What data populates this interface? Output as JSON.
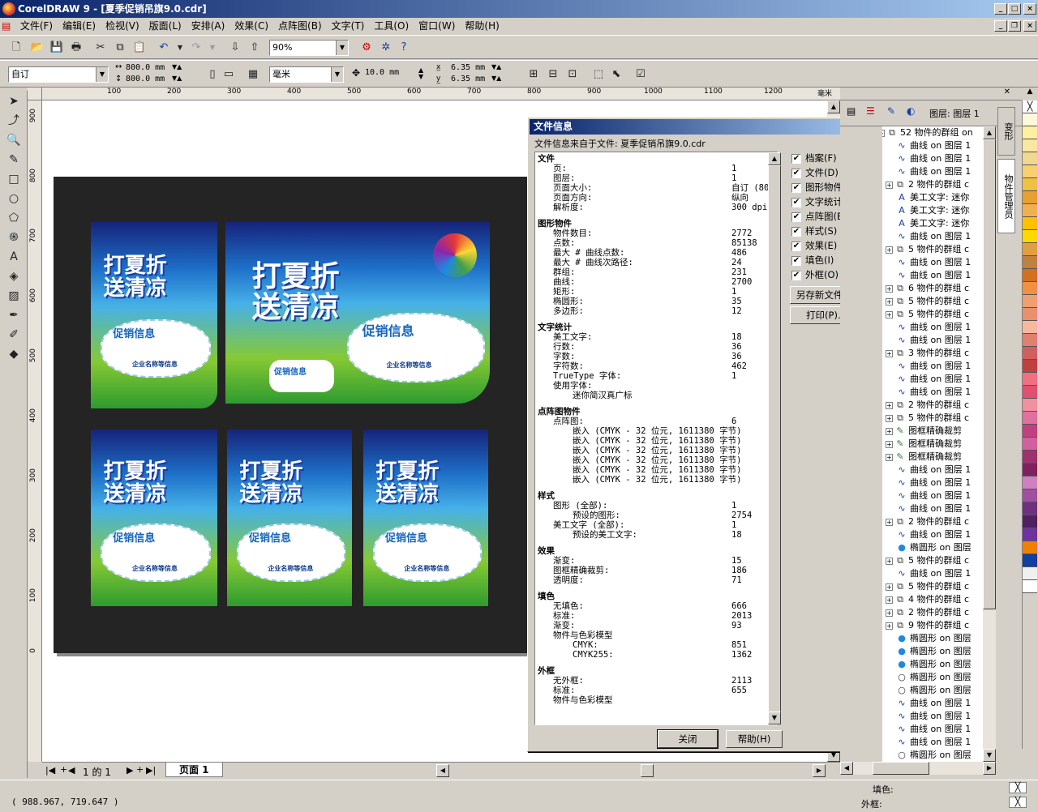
{
  "window": {
    "title": "CorelDRAW 9 - [夏季促销吊旗9.0.cdr]"
  },
  "menu": [
    "文件(F)",
    "编辑(E)",
    "检视(V)",
    "版面(L)",
    "安排(A)",
    "效果(C)",
    "点阵图(B)",
    "文字(T)",
    "工具(O)",
    "窗口(W)",
    "帮助(H)"
  ],
  "toolbar": {
    "zoom": "90%"
  },
  "propbar": {
    "paper": "自订",
    "width": "800.0",
    "height": "800.0",
    "unit_wh": "mm",
    "units": "毫米",
    "nudge": "10.0 mm",
    "dup_x": "6.35",
    "dup_y": "6.35",
    "dup_unit": "mm"
  },
  "ruler": {
    "h": [
      "100",
      "200",
      "300",
      "400",
      "500",
      "600",
      "700",
      "800",
      "900",
      "1000",
      "1100",
      "1200",
      "毫米"
    ],
    "v": [
      "900",
      "800",
      "700",
      "600",
      "500",
      "400",
      "300",
      "200",
      "100",
      "0"
    ]
  },
  "posters": {
    "title1": "打夏折",
    "title2": "送清凉",
    "bubble": "促销信息",
    "sub": "企业名称等信息"
  },
  "dialog": {
    "title": "文件信息",
    "help": "?",
    "source": "文件信息来自于文件: 夏季促销吊旗9.0.cdr",
    "rows": [
      {
        "h": "文件"
      },
      {
        "l": "页:",
        "v": "1"
      },
      {
        "l": "图层:",
        "v": "1"
      },
      {
        "l": "页面大小:",
        "v": "自订 (80"
      },
      {
        "l": "页面方向:",
        "v": "纵向"
      },
      {
        "l": "解析度:",
        "v": "300 dpi"
      },
      {
        "gap": true
      },
      {
        "h": "图形物件"
      },
      {
        "l": "物件数目:",
        "v": "2772"
      },
      {
        "l": "点数:",
        "v": "85138"
      },
      {
        "l": "最大 # 曲线点数:",
        "v": "486"
      },
      {
        "l": "最大 # 曲线次路径:",
        "v": "24"
      },
      {
        "l": "群组:",
        "v": "231"
      },
      {
        "l": "曲线:",
        "v": "2700"
      },
      {
        "l": "矩形:",
        "v": "1"
      },
      {
        "l": "椭圆形:",
        "v": "35"
      },
      {
        "l": "多边形:",
        "v": "12"
      },
      {
        "gap": true
      },
      {
        "h": "文字统计"
      },
      {
        "l": "美工文字:",
        "v": "18"
      },
      {
        "l": "行数:",
        "v": "36"
      },
      {
        "l": "字数:",
        "v": "36"
      },
      {
        "l": "字符数:",
        "v": "462"
      },
      {
        "l": "TrueType 字体:",
        "v": "1"
      },
      {
        "l": "使用字体:",
        "v": ""
      },
      {
        "l2": "迷你简汉真广标",
        "v": ""
      },
      {
        "gap": true
      },
      {
        "h": "点阵图物件"
      },
      {
        "l": "点阵图:",
        "v": "6"
      },
      {
        "l2": "嵌入 (CMYK - 32 位元, 1611380 字节)",
        "v": ""
      },
      {
        "l2": "嵌入 (CMYK - 32 位元, 1611380 字节)",
        "v": ""
      },
      {
        "l2": "嵌入 (CMYK - 32 位元, 1611380 字节)",
        "v": ""
      },
      {
        "l2": "嵌入 (CMYK - 32 位元, 1611380 字节)",
        "v": ""
      },
      {
        "l2": "嵌入 (CMYK - 32 位元, 1611380 字节)",
        "v": ""
      },
      {
        "l2": "嵌入 (CMYK - 32 位元, 1611380 字节)",
        "v": ""
      },
      {
        "gap": true
      },
      {
        "h": "样式"
      },
      {
        "l": "图形 (全部):",
        "v": "1"
      },
      {
        "l2": "预设的图形:",
        "v": "2754"
      },
      {
        "l": "美工文字 (全部):",
        "v": "1"
      },
      {
        "l2": "预设的美工文字:",
        "v": "18"
      },
      {
        "gap": true
      },
      {
        "h": "效果"
      },
      {
        "l": "渐变:",
        "v": "15"
      },
      {
        "l": "图框精确裁剪:",
        "v": "186"
      },
      {
        "l": "透明度:",
        "v": "71"
      },
      {
        "gap": true
      },
      {
        "h": "填色"
      },
      {
        "l": "无填色:",
        "v": "666"
      },
      {
        "l": "标准:",
        "v": "2013"
      },
      {
        "l": "渐变:",
        "v": "93"
      },
      {
        "l": "物件与色彩模型",
        "v": ""
      },
      {
        "l2": "CMYK:",
        "v": "851"
      },
      {
        "l2": "CMYK255:",
        "v": "1362"
      },
      {
        "gap": true
      },
      {
        "h": "外框"
      },
      {
        "l": "无外框:",
        "v": "2113"
      },
      {
        "l": "标准:",
        "v": "655"
      },
      {
        "l": "物件与色彩模型",
        "v": ""
      }
    ],
    "checks": [
      "档案(F)",
      "文件(D)",
      "图形物件(G)",
      "文字统计(T)",
      "点阵图(B)",
      "样式(S)",
      "效果(E)",
      "填色(I)",
      "外框(O)"
    ],
    "save_btn": "另存新文件(A)",
    "print_btn": "打印(P)...",
    "close_btn": "关闭",
    "help_btn": "帮助(H)"
  },
  "objects": {
    "header": "图层: 图层 1",
    "items": [
      {
        "t": "52 物件的群组 on",
        "ic": "grp",
        "pm": "-",
        "lvl": 0
      },
      {
        "t": "曲线 on 图层 1",
        "ic": "crv",
        "lvl": 1
      },
      {
        "t": "曲线 on 图层 1",
        "ic": "crv",
        "lvl": 1
      },
      {
        "t": "曲线 on 图层 1",
        "ic": "crv",
        "lvl": 1
      },
      {
        "t": "2 物件的群组 c",
        "ic": "grp",
        "pm": "+",
        "lvl": 1
      },
      {
        "t": "美工文字: 迷你",
        "ic": "txt",
        "lvl": 1
      },
      {
        "t": "美工文字: 迷你",
        "ic": "txt",
        "lvl": 1
      },
      {
        "t": "美工文字: 迷你",
        "ic": "txt",
        "lvl": 1
      },
      {
        "t": "曲线 on 图层 1",
        "ic": "crv",
        "lvl": 1
      },
      {
        "t": "5 物件的群组 c",
        "ic": "grp",
        "pm": "+",
        "lvl": 1
      },
      {
        "t": "曲线 on 图层 1",
        "ic": "crv",
        "lvl": 1
      },
      {
        "t": "曲线 on 图层 1",
        "ic": "crv",
        "lvl": 1
      },
      {
        "t": "6 物件的群组 c",
        "ic": "grp",
        "pm": "+",
        "lvl": 1
      },
      {
        "t": "5 物件的群组 c",
        "ic": "grp",
        "pm": "+",
        "lvl": 1
      },
      {
        "t": "5 物件的群组 c",
        "ic": "grp",
        "pm": "+",
        "lvl": 1
      },
      {
        "t": "曲线 on 图层 1",
        "ic": "crv",
        "lvl": 1
      },
      {
        "t": "曲线 on 图层 1",
        "ic": "crv",
        "lvl": 1
      },
      {
        "t": "3 物件的群组 c",
        "ic": "grp",
        "pm": "+",
        "lvl": 1
      },
      {
        "t": "曲线 on 图层 1",
        "ic": "crv",
        "lvl": 1
      },
      {
        "t": "曲线 on 图层 1",
        "ic": "crv",
        "lvl": 1
      },
      {
        "t": "曲线 on 图层 1",
        "ic": "crv",
        "lvl": 1
      },
      {
        "t": "2 物件的群组 c",
        "ic": "grp",
        "pm": "+",
        "lvl": 1
      },
      {
        "t": "5 物件的群组 c",
        "ic": "grp",
        "pm": "+",
        "lvl": 1
      },
      {
        "t": "图框精确裁剪",
        "ic": "pwc",
        "pm": "+",
        "lvl": 1
      },
      {
        "t": "图框精确裁剪",
        "ic": "pwc",
        "pm": "+",
        "lvl": 1
      },
      {
        "t": "图框精确裁剪",
        "ic": "pwc",
        "pm": "+",
        "lvl": 1
      },
      {
        "t": "曲线 on 图层 1",
        "ic": "crv",
        "lvl": 1
      },
      {
        "t": "曲线 on 图层 1",
        "ic": "crv",
        "lvl": 1
      },
      {
        "t": "曲线 on 图层 1",
        "ic": "crv",
        "lvl": 1
      },
      {
        "t": "曲线 on 图层 1",
        "ic": "crv",
        "lvl": 1
      },
      {
        "t": "2 物件的群组 c",
        "ic": "grp",
        "pm": "+",
        "lvl": 1
      },
      {
        "t": "曲线 on 图层 1",
        "ic": "crv",
        "lvl": 1
      },
      {
        "t": "椭圆形 on 图层",
        "ic": "ell",
        "lvl": 1
      },
      {
        "t": "5 物件的群组 c",
        "ic": "grp",
        "pm": "+",
        "lvl": 1
      },
      {
        "t": "曲线 on 图层 1",
        "ic": "crv",
        "lvl": 1
      },
      {
        "t": "5 物件的群组 c",
        "ic": "grp",
        "pm": "+",
        "lvl": 1
      },
      {
        "t": "4 物件的群组 c",
        "ic": "grp",
        "pm": "+",
        "lvl": 1
      },
      {
        "t": "2 物件的群组 c",
        "ic": "grp",
        "pm": "+",
        "lvl": 1
      },
      {
        "t": "9 物件的群组 c",
        "ic": "grp",
        "pm": "+",
        "lvl": 1
      },
      {
        "t": "椭圆形 on 图层",
        "ic": "ell",
        "lvl": 1
      },
      {
        "t": "椭圆形 on 图层",
        "ic": "ell",
        "lvl": 1
      },
      {
        "t": "椭圆形 on 图层",
        "ic": "ell",
        "lvl": 1
      },
      {
        "t": "椭圆形 on 图层",
        "ic": "elw",
        "lvl": 1
      },
      {
        "t": "椭圆形 on 图层",
        "ic": "elw",
        "lvl": 1
      },
      {
        "t": "曲线 on 图层 1",
        "ic": "crv",
        "lvl": 1
      },
      {
        "t": "曲线 on 图层 1",
        "ic": "crv",
        "lvl": 1
      },
      {
        "t": "曲线 on 图层 1",
        "ic": "crv",
        "lvl": 1
      },
      {
        "t": "曲线 on 图层 1",
        "ic": "crv",
        "lvl": 1
      },
      {
        "t": "椭圆形 on 图层",
        "ic": "elw",
        "lvl": 1
      }
    ]
  },
  "side_tabs": [
    "变形",
    "物件管理员"
  ],
  "page_nav": {
    "count": "1 的 1",
    "tab": "页面 1"
  },
  "status": {
    "coords": "( 988.967, 719.647 )",
    "fill_label": "填色:",
    "outline_label": "外框:"
  },
  "palette": [
    "#ffffff",
    "#fff8dc",
    "#fff0a0",
    "#f8e8a0",
    "#f0d890",
    "#f8d070",
    "#f0c040",
    "#e8a030",
    "#f0b050",
    "#ffc000",
    "#ffd800",
    "#e0a040",
    "#c08040",
    "#d07020",
    "#f09040",
    "#f0a070",
    "#e89070",
    "#f8b8a0",
    "#e08070",
    "#d06060",
    "#c04040",
    "#f07080",
    "#e05070",
    "#f090a0",
    "#e070a0",
    "#c04080",
    "#d060a0",
    "#a03070",
    "#802060",
    "#d080c0",
    "#a050a0",
    "#703080",
    "#502060",
    "#7030a0",
    "#f08000",
    "#1040a0",
    "#f0f0f0",
    "#ffffff"
  ]
}
